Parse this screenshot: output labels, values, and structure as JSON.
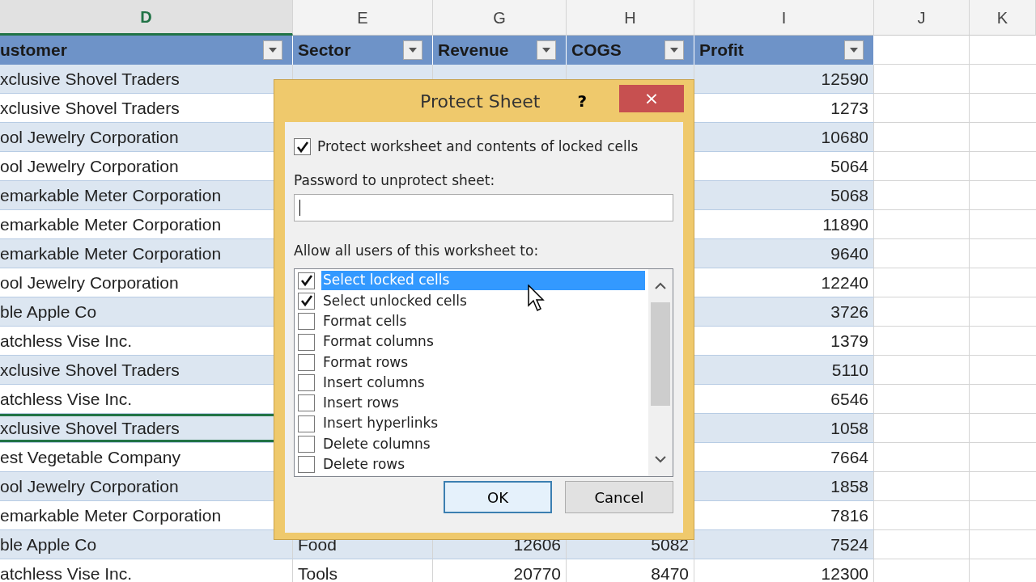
{
  "column_letters": [
    {
      "letter": "D",
      "selected": true
    },
    {
      "letter": "E",
      "selected": false
    },
    {
      "letter": "G",
      "selected": false
    },
    {
      "letter": "H",
      "selected": false
    },
    {
      "letter": "I",
      "selected": false
    },
    {
      "letter": "J",
      "selected": false
    },
    {
      "letter": "K",
      "selected": false
    }
  ],
  "table": {
    "headers": [
      "ustomer",
      "Sector",
      "Revenue",
      "COGS",
      "Profit"
    ],
    "rows": [
      {
        "customer": "xclusive Shovel Traders",
        "profit": "12590",
        "active": false
      },
      {
        "customer": "xclusive Shovel Traders",
        "profit": "1273",
        "active": false
      },
      {
        "customer": "ool Jewelry Corporation",
        "profit": "10680",
        "active": false
      },
      {
        "customer": "ool Jewelry Corporation",
        "profit": "5064",
        "active": false
      },
      {
        "customer": "emarkable Meter Corporation",
        "profit": "5068",
        "active": false
      },
      {
        "customer": "emarkable Meter Corporation",
        "profit": "11890",
        "active": false
      },
      {
        "customer": "emarkable Meter Corporation",
        "profit": "9640",
        "active": false
      },
      {
        "customer": "ool Jewelry Corporation",
        "profit": "12240",
        "active": false
      },
      {
        "customer": "ble Apple Co",
        "profit": "3726",
        "active": false
      },
      {
        "customer": "atchless Vise Inc.",
        "profit": "1379",
        "active": false
      },
      {
        "customer": "xclusive Shovel Traders",
        "profit": "5110",
        "active": false
      },
      {
        "customer": "atchless Vise Inc.",
        "profit": "6546",
        "active": false
      },
      {
        "customer": "xclusive Shovel Traders",
        "profit": "1058",
        "active": true
      },
      {
        "customer": "est Vegetable Company",
        "profit": "7664",
        "active": false
      },
      {
        "customer": "ool Jewelry Corporation",
        "profit": "1858",
        "active": false
      },
      {
        "customer": "emarkable Meter Corporation",
        "profit": "7816",
        "active": false
      },
      {
        "customer": "ble Apple Co",
        "sector": "Food",
        "revenue": "12606",
        "cogs": "5082",
        "profit": "7524",
        "active": false
      },
      {
        "customer": "atchless Vise Inc.",
        "sector": "Tools",
        "revenue": "20770",
        "cogs": "8470",
        "profit": "12300",
        "active": false
      }
    ]
  },
  "dialog": {
    "title": "Protect Sheet",
    "help": "?",
    "close": "×",
    "protect": {
      "label": "Protect worksheet and contents of locked cells",
      "checked": true
    },
    "password_label": "Password to unprotect sheet:",
    "allow_label": "Allow all users of this worksheet to:",
    "permissions": [
      {
        "label": "Select locked cells",
        "checked": true,
        "selected": true
      },
      {
        "label": "Select unlocked cells",
        "checked": true,
        "selected": false
      },
      {
        "label": "Format cells",
        "checked": false,
        "selected": false
      },
      {
        "label": "Format columns",
        "checked": false,
        "selected": false
      },
      {
        "label": "Format rows",
        "checked": false,
        "selected": false
      },
      {
        "label": "Insert columns",
        "checked": false,
        "selected": false
      },
      {
        "label": "Insert rows",
        "checked": false,
        "selected": false
      },
      {
        "label": "Insert hyperlinks",
        "checked": false,
        "selected": false
      },
      {
        "label": "Delete columns",
        "checked": false,
        "selected": false
      },
      {
        "label": "Delete rows",
        "checked": false,
        "selected": false
      }
    ],
    "buttons": [
      {
        "label": "OK",
        "default": true
      },
      {
        "label": "Cancel",
        "default": false
      }
    ]
  }
}
